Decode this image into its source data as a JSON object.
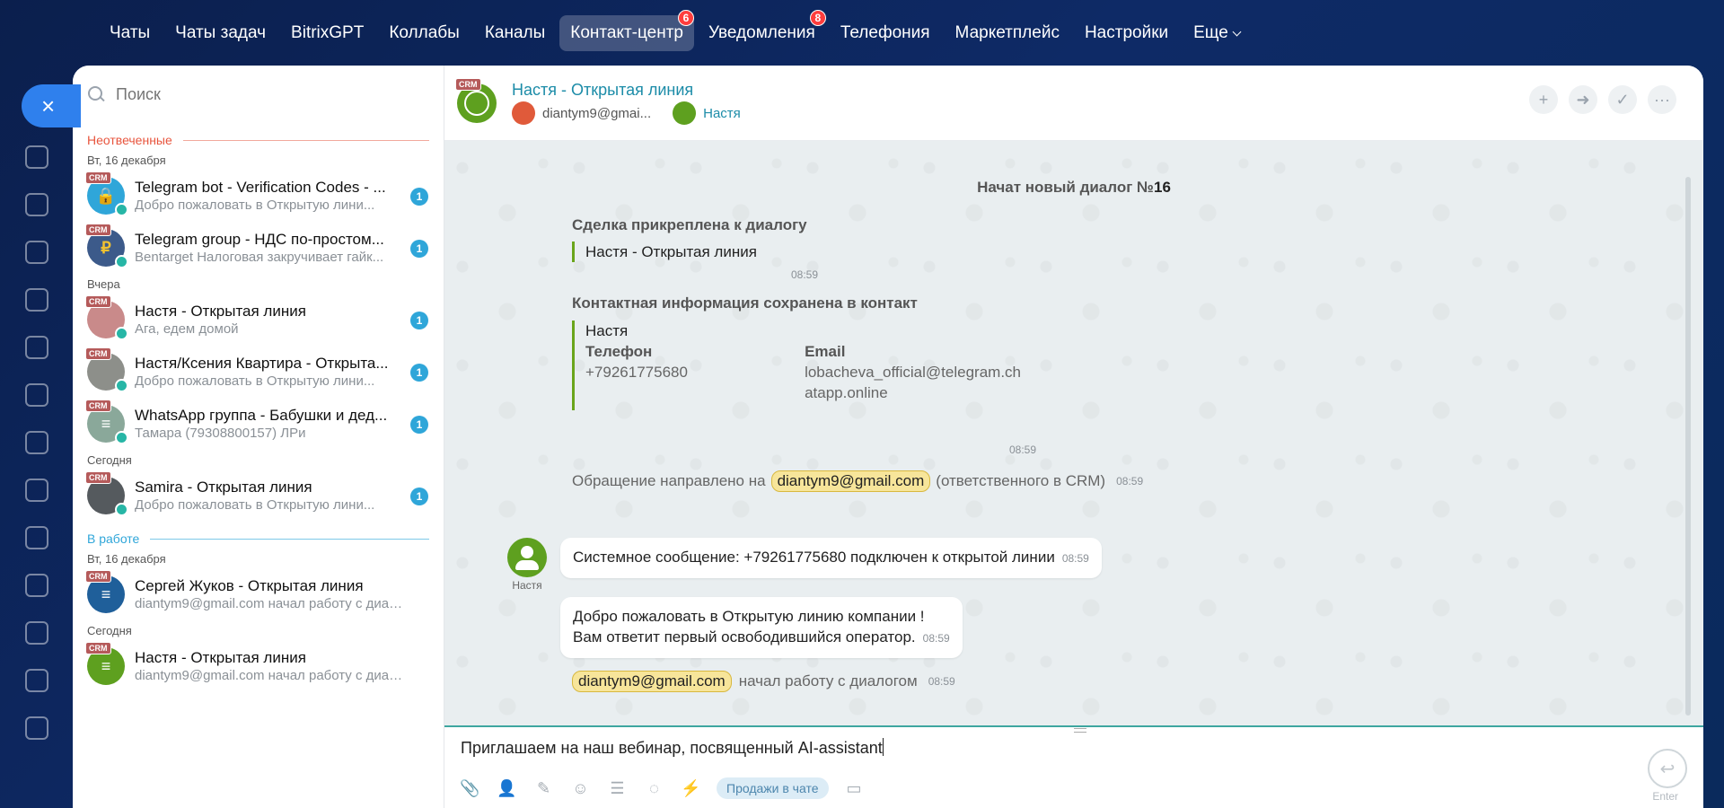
{
  "nav": {
    "items": [
      {
        "label": "Чаты"
      },
      {
        "label": "Чаты задач"
      },
      {
        "label": "BitrixGPT"
      },
      {
        "label": "Коллабы"
      },
      {
        "label": "Каналы"
      },
      {
        "label": "Контакт-центр",
        "badge": "6",
        "active": true
      },
      {
        "label": "Уведомления",
        "badge": "8"
      },
      {
        "label": "Телефония"
      },
      {
        "label": "Маркетплейс"
      },
      {
        "label": "Настройки"
      },
      {
        "label": "Еще"
      }
    ]
  },
  "close_icon": "×",
  "search": {
    "placeholder": "Поиск"
  },
  "sections": {
    "unanswered": "Неотвеченные",
    "in_work": "В работе"
  },
  "dates": {
    "d1": "Вт, 16 декабря",
    "d2": "Вчера",
    "d3": "Сегодня",
    "d4": "Вт, 16 декабря",
    "d5": "Сегодня"
  },
  "chats": [
    {
      "title": "Telegram bot - Verification Codes - ...",
      "last": "Добро пожаловать в Открытую лини...",
      "counter": "1",
      "crm": "CRM",
      "avatar_color": "#2fa6d9",
      "glyph": "🔒"
    },
    {
      "title": "Telegram group - НДС по-простом...",
      "last": "Bentarget Налоговая закручивает гайк...",
      "counter": "1",
      "crm": "CRM",
      "avatar_color": "#3c5a8a",
      "glyph": "₽"
    },
    {
      "title": "Настя - Открытая линия",
      "last": "Ага, едем домой",
      "counter": "1",
      "crm": "CRM",
      "avatar_color": "#c98a8a",
      "glyph": ""
    },
    {
      "title": "Настя/Ксения Квартира - Открыта...",
      "last": "Добро пожаловать в Открытую лини...",
      "counter": "1",
      "crm": "CRM",
      "avatar_color": "#8d8f8a",
      "glyph": ""
    },
    {
      "title": "WhatsApp группа - Бабушки и дед...",
      "last": "Тамара (79308800157) ЛРи",
      "counter": "1",
      "crm": "CRM",
      "avatar_color": "#8aa89a",
      "glyph": "≡"
    },
    {
      "title": "Samira - Открытая линия",
      "last": "Добро пожаловать в Открытую лини...",
      "counter": "1",
      "crm": "CRM",
      "avatar_color": "#555a5e",
      "glyph": ""
    },
    {
      "title": "Сергей Жуков - Открытая линия",
      "last": "diantym9@gmail.com начал работу с диал...",
      "crm": "CRM",
      "avatar_color": "#1f5f9a",
      "glyph": "≡"
    },
    {
      "title": "Настя - Открытая линия",
      "last": "diantym9@gmail.com начал работу с диал...",
      "crm": "CRM",
      "avatar_color": "#5ea01f",
      "glyph": "≡"
    }
  ],
  "header": {
    "crm": "CRM",
    "title": "Настя - Открытая линия",
    "user1": "diantym9@gmai...",
    "user2": "Настя"
  },
  "header_actions": [
    "+",
    "➜",
    "✓",
    "···"
  ],
  "messages": {
    "new_dialog_prefix": "Начат новый диалог №",
    "new_dialog_num": "16",
    "deal_title": "Сделка прикреплена к диалогу",
    "deal_name": "Настя - Открытая линия",
    "deal_time": "08:59",
    "contact_title": "Контактная информация сохранена в контакт",
    "contact_name": "Настя",
    "phone_label": "Телефон",
    "phone_value": "+79261775680",
    "email_label": "Email",
    "email_value_1": "lobacheva_official@telegram.ch",
    "email_value_2": "atapp.online",
    "contact_time": "08:59",
    "routed_prefix": "Обращение направлено на",
    "routed_user": "diantym9@gmail.com",
    "routed_suffix": "(ответственного в CRM)",
    "routed_time": "08:59",
    "system_msg": "Системное сообщение: +79261775680 подключен к открытой линии",
    "system_time": "08:59",
    "sender_name": "Настя",
    "welcome_1": "Добро пожаловать в Открытую линию компании !",
    "welcome_2": "Вам ответит первый освободившийся оператор.",
    "welcome_time": "08:59",
    "started_user": "diantym9@gmail.com",
    "started_text": "начал работу с диалогом",
    "started_time": "08:59"
  },
  "input": {
    "text": "Приглашаем на наш вебинар, посвященный AI-assistant",
    "sales_button": "Продажи в чате",
    "send_label": "Enter"
  }
}
